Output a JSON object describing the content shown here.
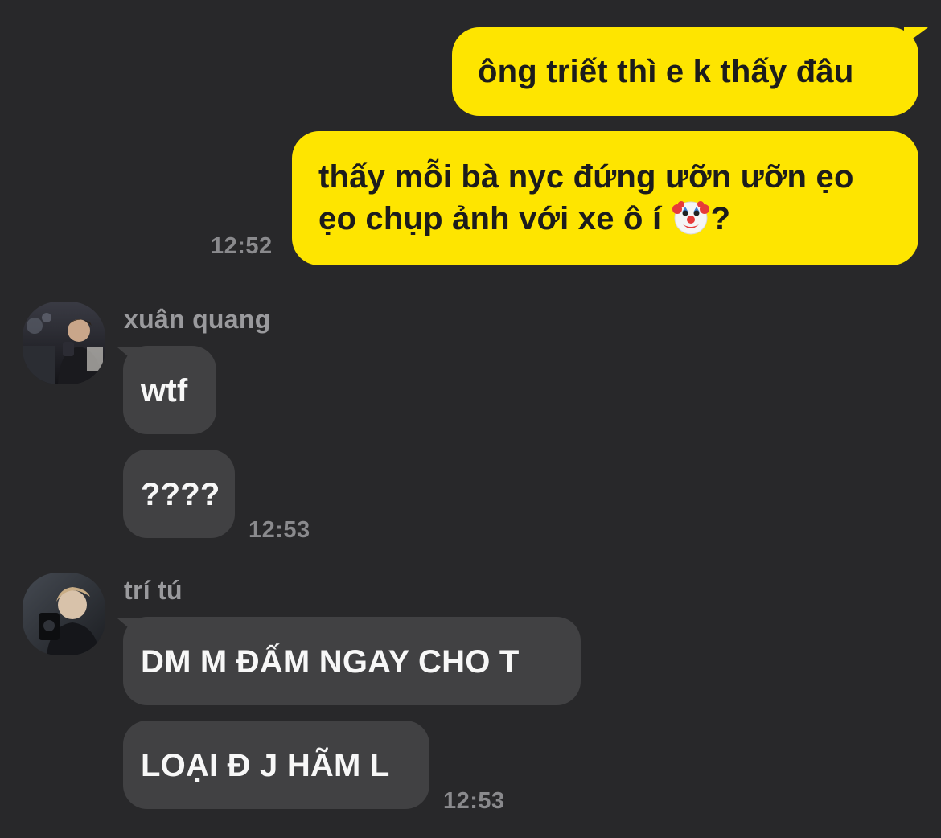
{
  "messages_out": [
    {
      "text": "ông triết thì e k thấy đâu"
    },
    {
      "text_line1": "thấy mỗi bà nyc đứng ưỡn ưỡn ẹo",
      "text_line2": "ẹo chụp ảnh với xe ô í",
      "emoji": "clown-face-icon",
      "text_after_emoji": "?",
      "time": "12:52"
    }
  ],
  "group1": {
    "sender": "xuân quang",
    "avatar": "avatar-xuan-quang",
    "messages": [
      "wtf",
      "????"
    ],
    "time": "12:53"
  },
  "group2": {
    "sender": "trí tú",
    "avatar": "avatar-tri-tu",
    "messages": [
      "DM M ĐẤM NGAY CHO T",
      "LOẠI Đ J HÃM L"
    ],
    "time": "12:53"
  },
  "colors": {
    "background": "#28282a",
    "outgoing_bubble": "#fee500",
    "incoming_bubble": "#414143",
    "timestamp": "#8a8a8d"
  }
}
